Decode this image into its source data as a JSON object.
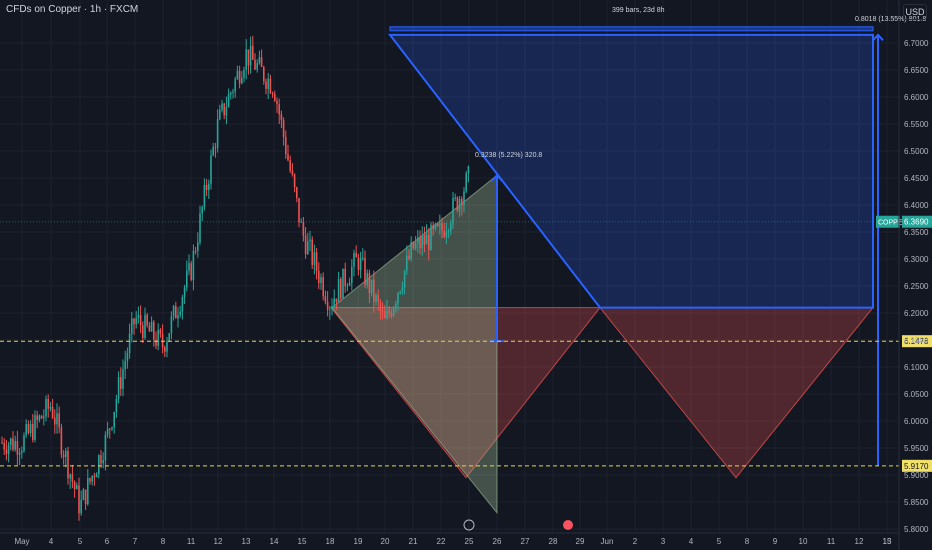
{
  "header": {
    "title": "CFDs on Copper · 1h · FXCM",
    "currency": "USD"
  },
  "chart_data": {
    "type": "candlestick",
    "title": "CFDs on Copper · 1h · FXCM",
    "x_tick_labels": [
      "May",
      "4",
      "5",
      "6",
      "7",
      "8",
      "11",
      "12",
      "13",
      "14",
      "15",
      "18",
      "19",
      "20",
      "21",
      "22",
      "25",
      "26",
      "27",
      "28",
      "29",
      "Jun",
      "2",
      "3",
      "4",
      "5",
      "8",
      "9",
      "10",
      "11",
      "12",
      "13",
      "15"
    ],
    "y_tick_labels": [
      "6.7000",
      "6.6500",
      "6.6000",
      "6.5500",
      "6.5000",
      "6.4500",
      "6.4000",
      "6.3500",
      "6.3000",
      "6.2500",
      "6.2000",
      "6.1500",
      "6.1000",
      "6.0500",
      "6.0000",
      "5.9500",
      "5.9000",
      "5.8500",
      "5.8000"
    ],
    "ylim": [
      5.8,
      6.7
    ],
    "price_path": [
      {
        "x": "May",
        "y": 5.96
      },
      {
        "x": "4",
        "y": 6.03
      },
      {
        "x": "5",
        "y": 5.84
      },
      {
        "x": "6",
        "y": 5.97
      },
      {
        "x": "7",
        "y": 6.19
      },
      {
        "x": "8",
        "y": 6.14
      },
      {
        "x": "11",
        "y": 6.28
      },
      {
        "x": "12",
        "y": 6.55
      },
      {
        "x": "13",
        "y": 6.68
      },
      {
        "x": "14",
        "y": 6.62
      },
      {
        "x": "15",
        "y": 6.35
      },
      {
        "x": "18",
        "y": 6.22
      },
      {
        "x": "19",
        "y": 6.3
      },
      {
        "x": "20",
        "y": 6.18
      },
      {
        "x": "21",
        "y": 6.32
      },
      {
        "x": "22",
        "y": 6.35
      },
      {
        "x": "25",
        "y": 6.45
      }
    ],
    "last_price": {
      "label": "COPPER",
      "value": "6.3690"
    },
    "horizontal_lines": [
      {
        "value": "6.1478"
      },
      {
        "value": "5.9170"
      }
    ],
    "annotations": [
      {
        "text": "0.3238 (5.22%) 320.8"
      },
      {
        "text": "399 bars, 23d 8h"
      },
      {
        "text": "0.8018 (13.55%) 801.8"
      }
    ],
    "colors": {
      "background": "#131722",
      "up": "#26a69a",
      "down": "#ef5350",
      "projection": "#2962ff",
      "highlight_line": "#e8d44d"
    },
    "grid": true
  }
}
